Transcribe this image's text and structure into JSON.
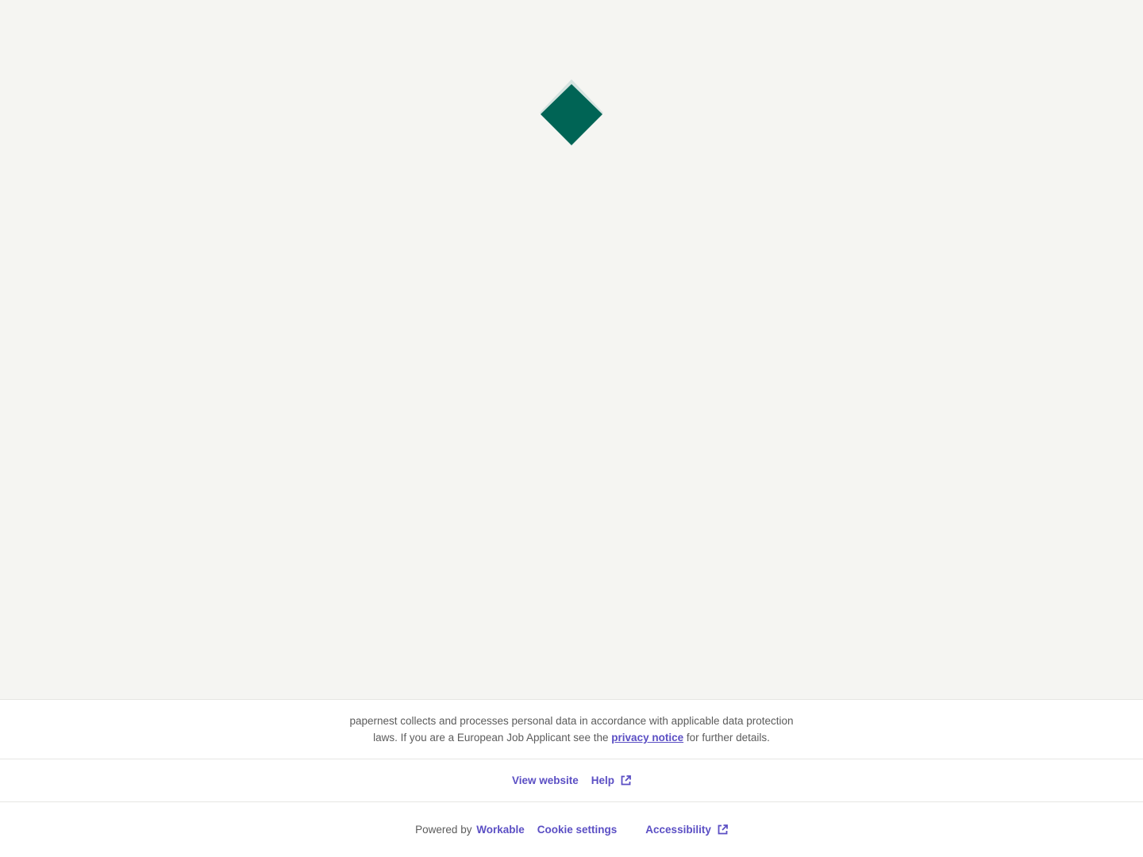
{
  "logo": {
    "icon": "diamond-logo-icon",
    "color": "#006455",
    "shadow_color": "#b9d3ce"
  },
  "privacy": {
    "text_before": "papernest collects and processes personal data in accordance with applicable data protection laws. If you are a European Job Applicant see the ",
    "link_label": "privacy notice",
    "text_after": " for further details."
  },
  "links": {
    "view_website": "View website",
    "help": "Help"
  },
  "bottom": {
    "powered_by": "Powered by",
    "workable": "Workable",
    "cookie_settings": "Cookie settings",
    "accessibility": "Accessibility"
  },
  "colors": {
    "accent": "#5b4fc4",
    "background": "#f5f5f2",
    "footer_bg": "#ffffff",
    "text_muted": "#5c5c5c"
  }
}
